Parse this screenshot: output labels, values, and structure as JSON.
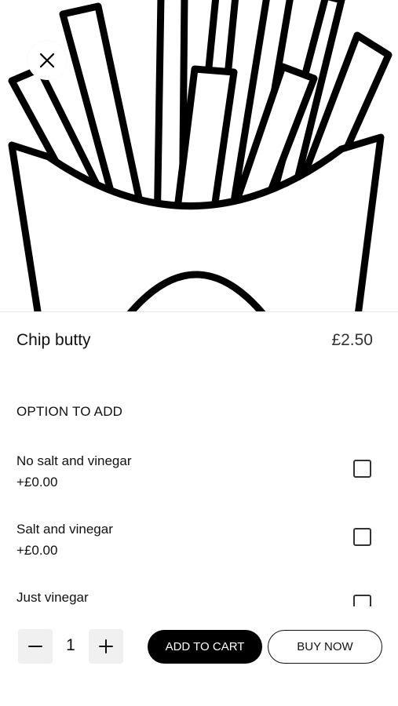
{
  "product": {
    "name": "Chip butty",
    "price": "£2.50"
  },
  "options_section": {
    "heading": "OPTION TO ADD",
    "items": [
      {
        "label": "No salt and vinegar",
        "price": "+£0.00",
        "checked": false
      },
      {
        "label": "Salt and vinegar",
        "price": "+£0.00",
        "checked": false
      },
      {
        "label": "Just vinegar",
        "checked": false
      }
    ]
  },
  "quantity": "1",
  "actions": {
    "add_to_cart": "ADD TO CART",
    "buy_now": "BUY NOW"
  },
  "icons": {
    "close": "close-icon",
    "minus": "minus-icon",
    "plus": "plus-icon",
    "hero": "french-fries-illustration"
  },
  "colors": {
    "primary_button": "#000000",
    "stepper_bg": "#f0f0f0"
  }
}
